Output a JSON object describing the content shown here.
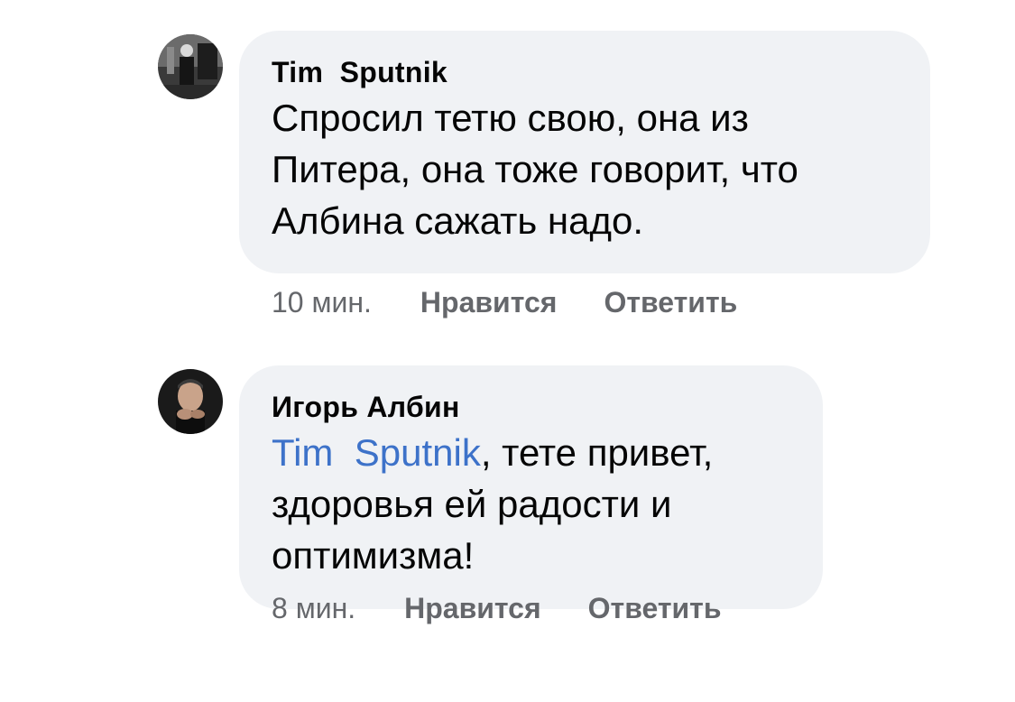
{
  "comments": [
    {
      "author": "Tim  Sputnik",
      "avatar_icon": "profile-photo-dark",
      "text": "Спросил тетю свою, она из Питера, она тоже говорит, что Албина сажать надо.",
      "text_lines": [
        "Спросил тетю свою, она из",
        "Питера, она тоже говорит, что",
        "Албина сажать надо."
      ],
      "time": "10 мин.",
      "like_label": "Нравится",
      "reply_label": "Ответить"
    },
    {
      "author": "Игорь Албин",
      "avatar_icon": "profile-photo-man",
      "mention": "Tim  Sputnik",
      "text_after_mention": ", тете привет,",
      "text_lines": [
        "здоровья ей радости и",
        "оптимизма!"
      ],
      "time": "8 мин.",
      "like_label": "Нравится",
      "reply_label": "Ответить"
    }
  ],
  "colors": {
    "bubble": "#f0f2f5",
    "mention": "#3d72c9",
    "meta": "#65676b",
    "text": "#050505"
  }
}
